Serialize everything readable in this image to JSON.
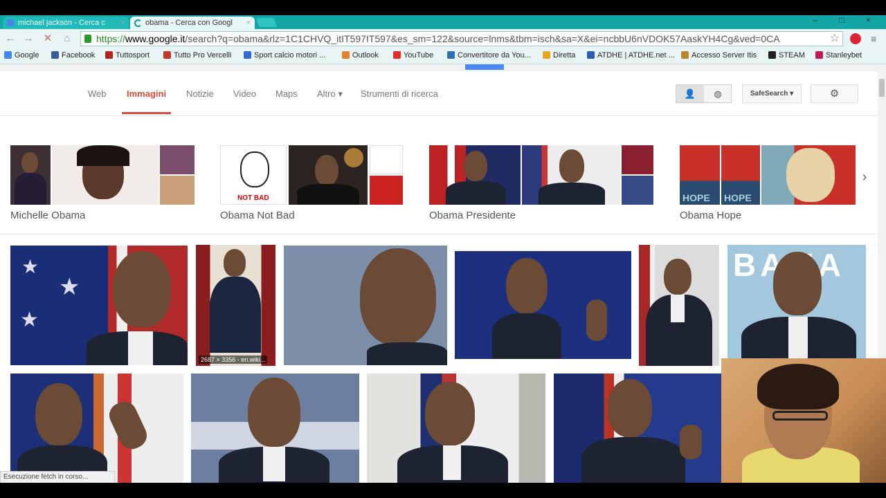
{
  "tabs": [
    {
      "label": "michael jackson - Cerca c",
      "close": "×"
    },
    {
      "label": "obama - Cerca con Googl",
      "close": "×"
    }
  ],
  "window_controls": "– □ ×",
  "nav_buttons": {
    "back": "←",
    "forward": "→",
    "stop": "✕",
    "home": "⌂"
  },
  "address": {
    "scheme": "https://",
    "host": "www.google.it",
    "path": "/search?q=obama&rlz=1C1CHVQ_itIT597IT597&es_sm=122&source=lnms&tbm=isch&sa=X&ei=ncbbU6nVDOK57AaskYH4Cg&ved=0CA",
    "star": "☆"
  },
  "bookmarks": [
    {
      "label": "Google",
      "color": "#4285f4"
    },
    {
      "label": "Facebook",
      "color": "#3b5998"
    },
    {
      "label": "Tuttosport",
      "color": "#b22222"
    },
    {
      "label": "Tutto Pro Vercelli",
      "color": "#c0392b"
    },
    {
      "label": "Sport calcio motori ...",
      "color": "#3367d6"
    },
    {
      "label": "Outlook",
      "color": "#e8812d"
    },
    {
      "label": "YouTube",
      "color": "#e52d27"
    },
    {
      "label": "Convertitore da You...",
      "color": "#2c6fb5"
    },
    {
      "label": "Diretta",
      "color": "#e6a817"
    },
    {
      "label": "ATDHE | ATDHE.net ...",
      "color": "#2b5fad"
    },
    {
      "label": "Accesso Server Itis",
      "color": "#b8862b"
    },
    {
      "label": "STEAM",
      "color": "#222222"
    },
    {
      "label": "Stanleybet",
      "color": "#c2185b"
    }
  ],
  "search_nav": {
    "items": [
      "Web",
      "Immagini",
      "Notizie",
      "Video",
      "Maps",
      "Altro ▾",
      "Strumenti di ricerca"
    ],
    "active": "Immagini",
    "safesearch": "SafeSearch ▾",
    "settings_icon": "gear-icon",
    "settings_glyph": "⚙",
    "account_glyph": "👤",
    "globe_glyph": "◍"
  },
  "related_searches": [
    {
      "label": "Michelle Obama"
    },
    {
      "label": "Obama Not Bad",
      "thumb_text": "NOT BAD"
    },
    {
      "label": "Obama Presidente"
    },
    {
      "label": "Obama Hope",
      "thumb_text": "HOPE"
    }
  ],
  "next_arrow": "›",
  "results": {
    "row1_caption": "2687 × 3356 - en.wiki...",
    "poster_text": "BAMA"
  },
  "status": "Esecuzione fetch in corso...",
  "colors": {
    "accent": "#dd4b39",
    "chrome": "#13a6a6"
  }
}
